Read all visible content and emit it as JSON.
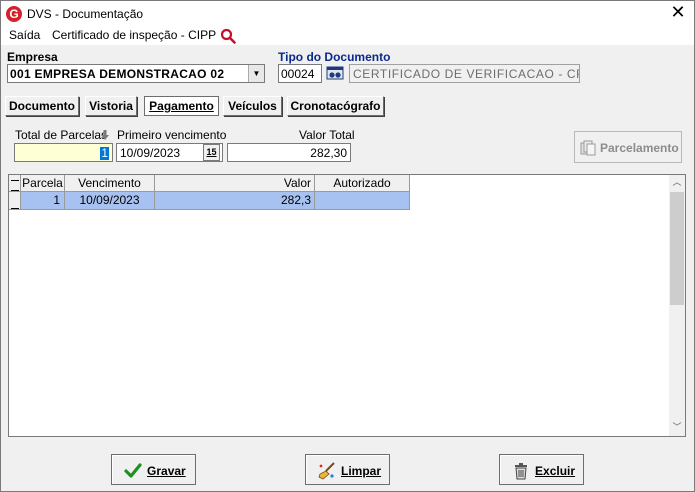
{
  "window": {
    "title": "DVS - Documentação",
    "logo_letter": "G",
    "close_glyph": "✕"
  },
  "menu": {
    "items": [
      "Saída",
      "Certificado de inspeção - CIPP"
    ]
  },
  "empresa": {
    "label": "Empresa",
    "value": "001 EMPRESA DEMONSTRACAO 02"
  },
  "tipo_documento": {
    "label": "Tipo do Documento",
    "code": "00024",
    "description": "CERTIFICADO DE VERIFICACAO - CRO"
  },
  "tabs": [
    {
      "label": "Documento",
      "active": false
    },
    {
      "label": "Vistoria",
      "active": false
    },
    {
      "label": "Pagamento",
      "active": true
    },
    {
      "label": "Veículos",
      "active": false
    },
    {
      "label": "Cronotacógrafo",
      "active": false
    }
  ],
  "pagamento": {
    "total_parcelas_label": "Total de Parcelas",
    "total_parcelas_value": "1",
    "primeiro_vencimento_label": "Primeiro vencimento",
    "primeiro_vencimento_value": "10/09/2023",
    "calendar_label": "15",
    "valor_total_label": "Valor Total",
    "valor_total_value": "282,30",
    "parcelamento_button": "Parcelamento"
  },
  "grid": {
    "columns": [
      "Parcela",
      "Vencimento",
      "Valor",
      "Autorizado"
    ],
    "rows": [
      {
        "parcela": "1",
        "vencimento": "10/09/2023",
        "valor": "282,3",
        "autorizado": ""
      }
    ]
  },
  "buttons": {
    "gravar": "Gravar",
    "limpar": "Limpar",
    "excluir": "Excluir"
  },
  "colors": {
    "selection": "#a7c2f0",
    "yellow_field": "#ffffd5",
    "brand_red": "#d6202a",
    "title_blue": "#0a2a8c"
  }
}
